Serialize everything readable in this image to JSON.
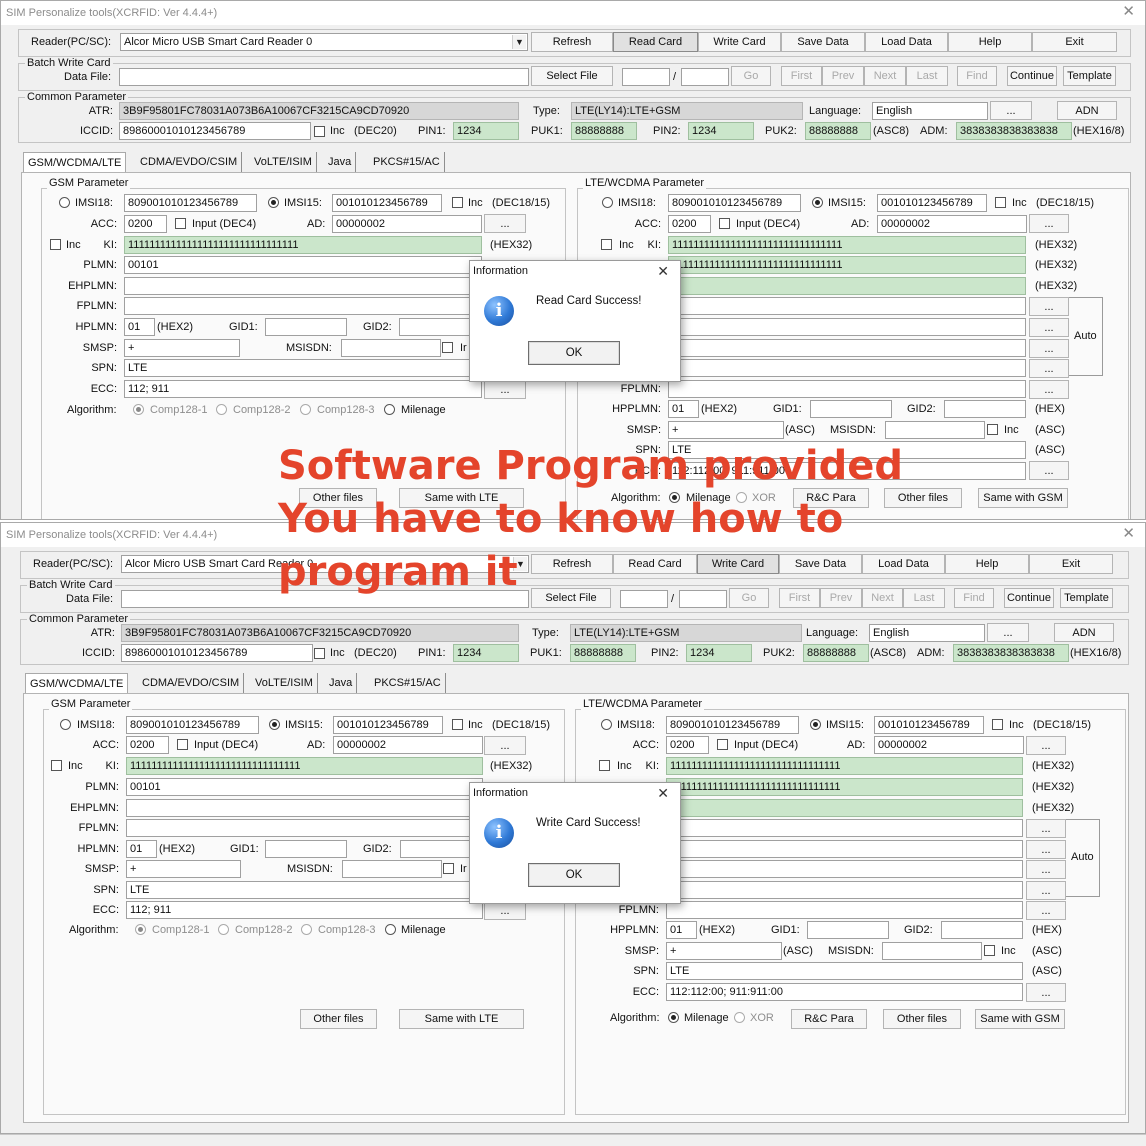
{
  "window_title": "SIM Personalize tools(XCRFID: Ver 4.4.4+)",
  "window_close": "✕",
  "toolbar": {
    "reader_label": "Reader(PC/SC):",
    "reader_value": "Alcor Micro USB Smart Card Reader 0",
    "refresh": "Refresh",
    "read_card": "Read Card",
    "write_card": "Write Card",
    "save_data": "Save Data",
    "load_data": "Load Data",
    "help": "Help",
    "exit": "Exit"
  },
  "batch": {
    "group_title": "Batch Write Card",
    "data_file_label": "Data File:",
    "select_file": "Select File",
    "slash": "/",
    "go": "Go",
    "first": "First",
    "prev": "Prev",
    "next": "Next",
    "last": "Last",
    "find": "Find",
    "continue": "Continue",
    "template": "Template"
  },
  "common": {
    "group_title": "Common Parameter",
    "atr_label": "ATR:",
    "atr_value": "3B9F95801FC78031A073B6A10067CF3215CA9CD70920",
    "type_label": "Type:",
    "type_value": "LTE(LY14):LTE+GSM",
    "language_label": "Language:",
    "language_value": "English",
    "ellipsis": "...",
    "adn": "ADN",
    "iccid_label": "ICCID:",
    "iccid_value": "89860001010123456789",
    "inc_label": "Inc",
    "dec20": "(DEC20)",
    "pin1_label": "PIN1:",
    "pin1_value": "1234",
    "puk1_label": "PUK1:",
    "puk1_value": "88888888",
    "pin2_label": "PIN2:",
    "pin2_value": "1234",
    "puk2_label": "PUK2:",
    "puk2_value": "88888888",
    "asc8": "(ASC8)",
    "adm_label": "ADM:",
    "adm_value": "3838383838383838",
    "hex16_8": "(HEX16/8)"
  },
  "tabs": [
    "GSM/WCDMA/LTE",
    "CDMA/EVDO/CSIM",
    "VoLTE/ISIM",
    "Java",
    "PKCS#15/AC"
  ],
  "gsm": {
    "group_title": "GSM Parameter",
    "imsi18_label": "IMSI18:",
    "imsi18_value": "809001010123456789",
    "imsi15_label": "IMSI15:",
    "imsi15_value": "001010123456789",
    "inc_label": "Inc",
    "dec18_15": "(DEC18/15)",
    "acc_label": "ACC:",
    "acc_value": "0200",
    "input_dec4": "Input (DEC4)",
    "ad_label": "AD:",
    "ad_value": "00000002",
    "ellipsis": "...",
    "ki_label": "KI:",
    "ki_value": "11111111111111111111111111111111",
    "hex32": "(HEX32)",
    "plmn_label": "PLMN:",
    "plmn_value": "00101",
    "ehplmn_label": "EHPLMN:",
    "fplmn_label": "FPLMN:",
    "hplmn_label": "HPLMN:",
    "hplmn_value": "01",
    "hex2": "(HEX2)",
    "gid1_label": "GID1:",
    "gid2_label": "GID2:",
    "smsp_label": "SMSP:",
    "smsp_value": "+",
    "msisdn_label": "MSISDN:",
    "inc_cut": "Ir",
    "spn_label": "SPN:",
    "spn_value": "LTE",
    "ecc_label": "ECC:",
    "ecc_value": "112; 911",
    "algorithm_label": "Algorithm:",
    "comp1": "Comp128-1",
    "comp2": "Comp128-2",
    "comp3": "Comp128-3",
    "milenage": "Milenage",
    "other_files": "Other files",
    "same_with_lte": "Same with LTE"
  },
  "lte": {
    "group_title": "LTE/WCDMA Parameter",
    "imsi18_label": "IMSI18:",
    "imsi18_value": "809001010123456789",
    "imsi15_label": "IMSI15:",
    "imsi15_value": "001010123456789",
    "inc_label": "Inc",
    "dec18_15": "(DEC18/15)",
    "acc_label": "ACC:",
    "acc_value": "0200",
    "input_dec4": "Input (DEC4)",
    "ad_label": "AD:",
    "ad_value": "00000002",
    "ellipsis": "...",
    "ki_label": "KI:",
    "ki_value": "11111111111111111111111111111111",
    "opc_value": "11111111111111111111111111111111",
    "hex32": "(HEX32)",
    "auto": "Auto",
    "fplmn_label": "FPLMN:",
    "hpplmn_label": "HPPLMN:",
    "hpplmn_value": "01",
    "hex2": "(HEX2)",
    "gid1_label": "GID1:",
    "gid2_label": "GID2:",
    "hex": "(HEX)",
    "smsp_label": "SMSP:",
    "smsp_value": "+",
    "asc": "(ASC)",
    "msisdn_label": "MSISDN:",
    "spn_label": "SPN:",
    "spn_value": "LTE",
    "ecc_label": "ECC:",
    "ecc_value": "112:112:00; 911:911:00",
    "algorithm_label": "Algorithm:",
    "milenage": "Milenage",
    "xor": "XOR",
    "rc_para": "R&C Para",
    "other_files": "Other files",
    "same_with_gsm": "Same with GSM"
  },
  "dialog_top": {
    "title": "Information",
    "close": "✕",
    "icon": "i",
    "message": "Read Card Success!",
    "ok": "OK"
  },
  "dialog_bottom": {
    "title": "Information",
    "close": "✕",
    "icon": "i",
    "message": "Write Card Success!",
    "ok": "OK"
  },
  "overlay": {
    "line1": "Software Program provided",
    "line2": "You have to know how to",
    "line3": "program it"
  },
  "colors": {
    "overlay_text": "#e4442b",
    "green_field": "#cbe6cb",
    "gray_field": "#d7d7d7",
    "window_bg": "#f0f0f0"
  },
  "icons": {
    "close": "close-icon",
    "info": "info-icon",
    "dropdown": "chevron-down-icon"
  }
}
